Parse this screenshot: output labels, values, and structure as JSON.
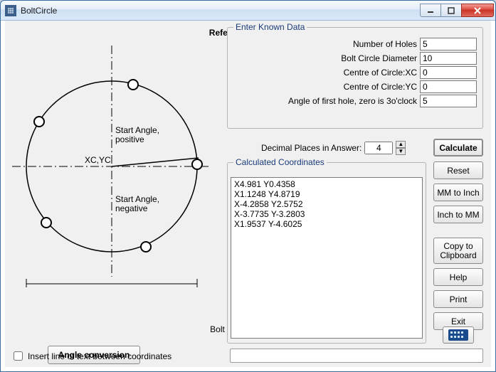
{
  "window": {
    "title": "BoltCircle"
  },
  "diagram": {
    "title": "Reference Diagram",
    "start_angle_pos": "Start Angle,\npositive",
    "start_angle_neg": "Start Angle,\nnegative",
    "center_label": "XC,YC",
    "bcd_label": "Bolt Circle Diameter"
  },
  "buttons": {
    "angle_conversion": "Angle conversion",
    "calculate": "Calculate",
    "reset": "Reset",
    "mm_to_inch": "MM to Inch",
    "inch_to_mm": "Inch to MM",
    "copy_clipboard": "Copy to\nClipboard",
    "help": "Help",
    "print": "Print",
    "exit": "Exit"
  },
  "known": {
    "legend": "Enter Known Data",
    "num_holes_label": "Number of Holes",
    "num_holes": "5",
    "bcd_label": "Bolt Circle Diameter",
    "bcd": "10",
    "xc_label": "Centre of Circle:XC",
    "xc": "0",
    "yc_label": "Centre of Circle:YC",
    "yc": "0",
    "angle_label": "Angle of first hole, zero is 3o'clock",
    "angle": "5"
  },
  "decimal": {
    "label": "Decimal Places in Answer:",
    "value": "4"
  },
  "coords": {
    "legend": "Calculated Coordinates",
    "text": "X4.981 Y0.4358\nX1.1248 Y4.8719\nX-4.2858 Y2.5752\nX-3.7735 Y-3.2803\nX1.9537 Y-4.6025"
  },
  "insert_label": "Insert line of text between coordinates",
  "status": ""
}
